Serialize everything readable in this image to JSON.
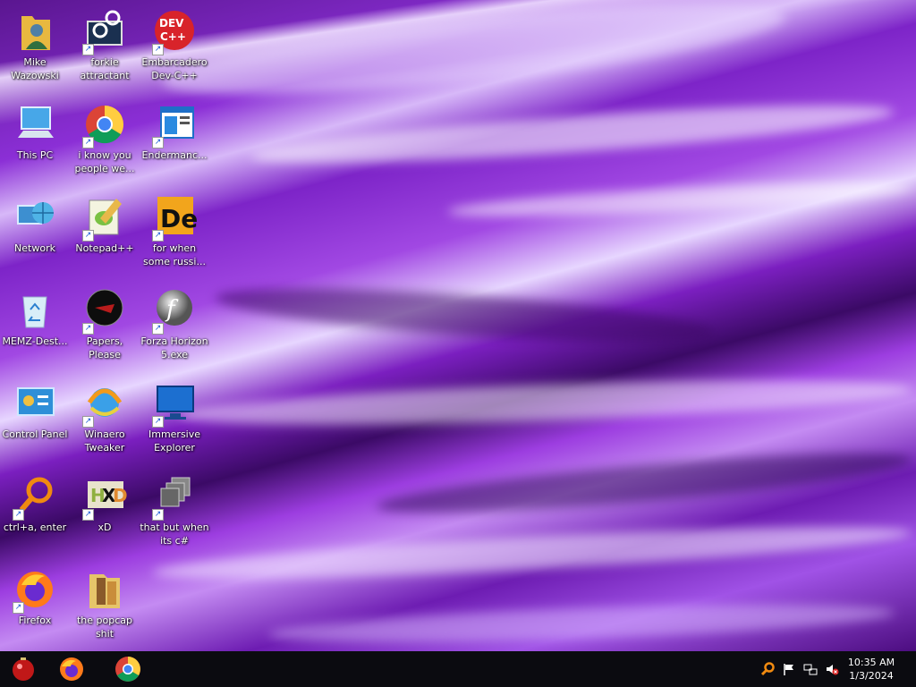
{
  "desktop": {
    "icons": [
      {
        "label": "Mike Wazowski",
        "icon": "user-folder-icon"
      },
      {
        "label": "forkie attractant",
        "icon": "gear-monitor-icon"
      },
      {
        "label": "Embarcadero Dev-C++",
        "icon": "devcpp-icon"
      },
      {
        "label": "This PC",
        "icon": "computer-icon"
      },
      {
        "label": "i know you people we...",
        "icon": "chrome-icon"
      },
      {
        "label": "Endermanc...",
        "icon": "window-app-icon"
      },
      {
        "label": "Network",
        "icon": "network-icon"
      },
      {
        "label": "Notepad++",
        "icon": "notepadpp-icon"
      },
      {
        "label": "for when some russi...",
        "icon": "de-icon"
      },
      {
        "label": "MEMZ-Dest...",
        "icon": "recycle-bin-icon"
      },
      {
        "label": "Papers, Please",
        "icon": "papers-please-icon"
      },
      {
        "label": "Forza Horizon 5.exe",
        "icon": "flash-icon"
      },
      {
        "label": "Control Panel",
        "icon": "control-panel-icon"
      },
      {
        "label": "Winaero Tweaker",
        "icon": "winaero-icon"
      },
      {
        "label": "Immersive Explorer",
        "icon": "monitor-icon"
      },
      {
        "label": "ctrl+a, enter",
        "icon": "magnifier-icon"
      },
      {
        "label": "xD",
        "icon": "hxd-icon"
      },
      {
        "label": "that but when its c#",
        "icon": "stacked-windows-icon"
      },
      {
        "label": "Firefox",
        "icon": "firefox-icon"
      },
      {
        "label": "the popcap shit",
        "icon": "popcap-folder-icon"
      }
    ]
  },
  "taskbar": {
    "pinned": [
      {
        "name": "start-orb-icon"
      },
      {
        "name": "firefox-icon"
      },
      {
        "name": "chrome-icon"
      }
    ],
    "tray": [
      "search-icon",
      "flag-icon",
      "network-tray-icon",
      "volume-muted-icon"
    ],
    "time": "10:35 AM",
    "date": "1/3/2024"
  }
}
